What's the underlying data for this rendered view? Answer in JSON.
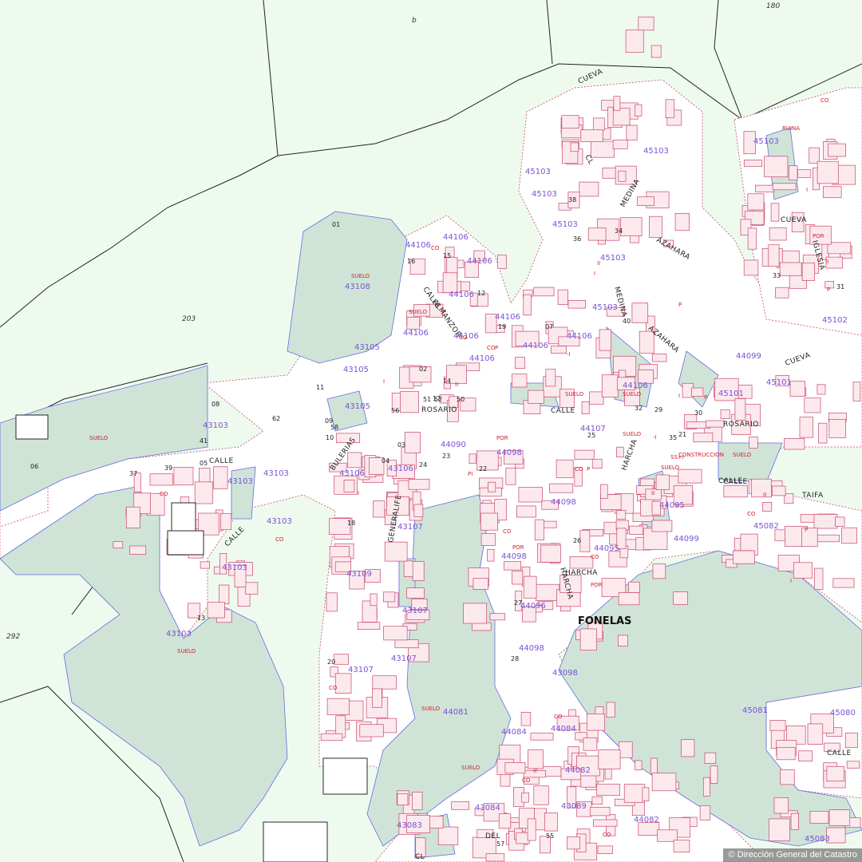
{
  "map": {
    "place_name": "FONELAS",
    "attribution": "© Dirección General del Catastro",
    "colors": {
      "background": "#eefaee",
      "urban_ground": "#ffffff",
      "green_plot": "#cfe4d7",
      "building": "#fbe9ee",
      "building_stroke": "#c9476a",
      "parcel_stroke": "#6a6ae0",
      "parcel_label": "#7a52d6",
      "use_label": "#d0202a",
      "line": "#222222"
    },
    "area_codes": [
      "180",
      "203",
      "292",
      "b"
    ],
    "streets": [
      {
        "id": "calle-rosario-1",
        "text": "CALLE"
      },
      {
        "id": "calle-rosario-2",
        "text": "ROSARIO"
      },
      {
        "id": "calle-rosario-3",
        "text": "CALLE"
      },
      {
        "id": "calle-rosario-4",
        "text": "ROSARIO"
      },
      {
        "id": "calle-almanzor-1",
        "text": "CALLE"
      },
      {
        "id": "calle-almanzor-2",
        "text": "ALMANZOR"
      },
      {
        "id": "bulerias",
        "text": "BULERIAS"
      },
      {
        "id": "generalife",
        "text": "GENERALIFE"
      },
      {
        "id": "medina-1",
        "text": "MEDINA"
      },
      {
        "id": "medina-2",
        "text": "MEDINA"
      },
      {
        "id": "azahara-1",
        "text": "AZAHARA"
      },
      {
        "id": "azahara-2",
        "text": "AZAHARA"
      },
      {
        "id": "harcha-1",
        "text": "HARCHA"
      },
      {
        "id": "harcha-2",
        "text": "HARCHA"
      },
      {
        "id": "harcha-3",
        "text": "HARCHA"
      },
      {
        "id": "taifa-1",
        "text": "CALLE"
      },
      {
        "id": "taifa-2",
        "text": "TAIFA"
      },
      {
        "id": "cueva-1",
        "text": "CUEVA"
      },
      {
        "id": "cueva-2",
        "text": "CUEVA"
      },
      {
        "id": "cueva-3",
        "text": "CUEVA"
      },
      {
        "id": "iglesia",
        "text": "IGLESIA"
      },
      {
        "id": "calle-west",
        "text": "CALLE"
      },
      {
        "id": "calle-sw",
        "text": "CALLE"
      },
      {
        "id": "calle-se",
        "text": "CALLE"
      },
      {
        "id": "del",
        "text": "DEL"
      },
      {
        "id": "cl-1",
        "text": "CL"
      },
      {
        "id": "cl-2",
        "text": "CL"
      }
    ],
    "parcels": [
      "43108",
      "44106",
      "44106",
      "44106",
      "44106",
      "44106",
      "44106",
      "44106",
      "44106",
      "44106",
      "44106",
      "43105",
      "43105",
      "43105",
      "43103",
      "43103",
      "43103",
      "43103",
      "43103",
      "43103",
      "43106",
      "43106",
      "43107",
      "43107",
      "43107",
      "43107",
      "43109",
      "44090",
      "44098",
      "44098",
      "44098",
      "44098",
      "44099",
      "44095",
      "44095",
      "44096",
      "44099",
      "45082",
      "45103",
      "45103",
      "45103",
      "45103",
      "45103",
      "45103",
      "45101",
      "45101",
      "45102",
      "45103",
      "44081",
      "44084",
      "44084",
      "44082",
      "43084",
      "43083",
      "43089",
      "44082",
      "44107",
      "43098",
      "45081",
      "45080",
      "45083",
      "44106"
    ],
    "subparcels": [
      "01",
      "02",
      "03",
      "04",
      "05",
      "06",
      "07",
      "08",
      "09",
      "10",
      "11",
      "12",
      "13",
      "14",
      "15",
      "16",
      "17",
      "18",
      "19",
      "20",
      "21",
      "22",
      "23",
      "24",
      "25",
      "26",
      "27",
      "28",
      "29",
      "30",
      "31",
      "32",
      "33",
      "34",
      "35",
      "36",
      "37",
      "38",
      "39",
      "40",
      "41",
      "50",
      "51",
      "52",
      "55",
      "56",
      "57",
      "58",
      "62"
    ],
    "uses": [
      "SUELO",
      "CO",
      "P",
      "POR",
      "I",
      "II",
      "-I",
      "PI",
      "SS+I",
      "RUINA",
      "CONSTRUCCION"
    ]
  }
}
